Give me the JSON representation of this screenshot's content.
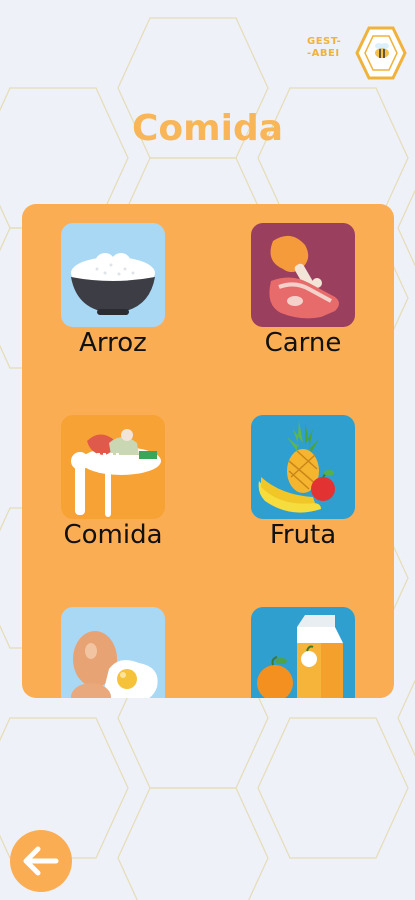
{
  "app": {
    "logo_text": "GEST-\n-ABEI"
  },
  "page": {
    "title": "Comida"
  },
  "categories": [
    {
      "label": "Arroz",
      "icon": "rice-bowl-icon",
      "bg": "#a9d8f4"
    },
    {
      "label": "Carne",
      "icon": "meat-icon",
      "bg": "#9b3f5e"
    },
    {
      "label": "Comida",
      "icon": "meal-plate-icon",
      "bg": "#f7a234"
    },
    {
      "label": "Fruta",
      "icon": "fruit-icon",
      "bg": "#2f9fcf"
    },
    {
      "label": "",
      "icon": "eggs-icon",
      "bg": "#a9d8f4"
    },
    {
      "label": "",
      "icon": "juice-carton-icon",
      "bg": "#2f9fcf"
    }
  ],
  "colors": {
    "accent": "#fbad54",
    "title": "#f8b659",
    "background": "#eef1f7",
    "hex_outline": "#e9d9a8"
  },
  "back_button": {
    "icon": "arrow-left-icon"
  }
}
